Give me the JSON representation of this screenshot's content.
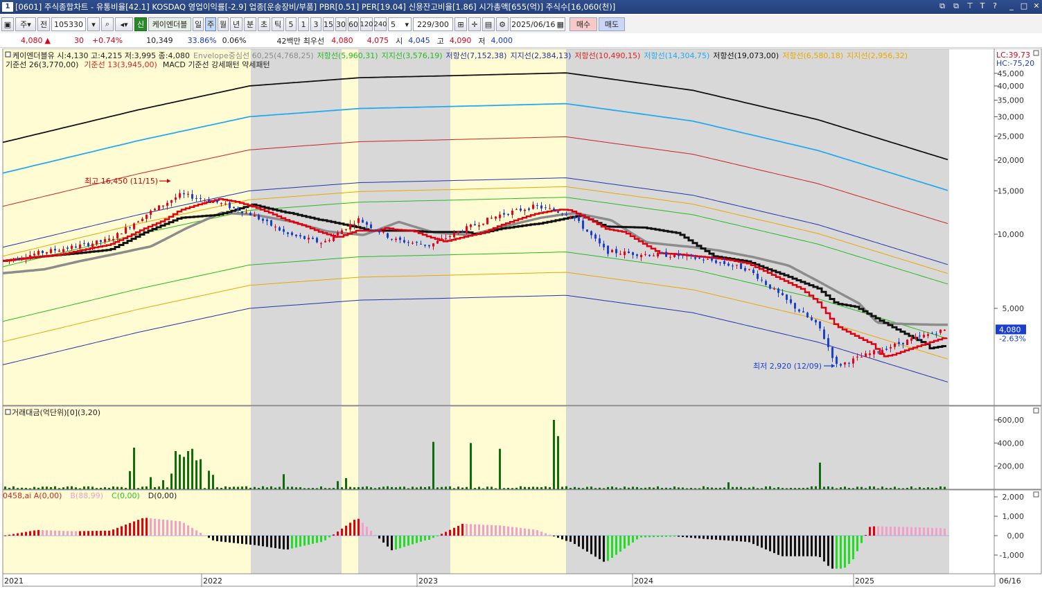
{
  "window": {
    "number": "1",
    "title": "[0601] 주식종합차트 - 유통비율[42.1] KOSDAQ 영업이익률[-2.9] 업종[운송장비/부품] PBR[0.51] PER[19.04] 신용잔고비율[1.86] 시가총액[655(억)] 주식수[16,060(천)]",
    "controls": [
      "⧉",
      "⧉",
      "T",
      "?",
      "_",
      "□",
      "✕"
    ]
  },
  "toolbar": {
    "market_code": "주",
    "prev_label": "전",
    "stock_code": "105330",
    "credit_badge": "신",
    "stock_name": "케이엔더블",
    "periods": [
      "일",
      "주",
      "월",
      "년",
      "분",
      "초",
      "틱"
    ],
    "active_period": "주",
    "intervals": [
      "5",
      "1",
      "3",
      "15",
      "30",
      "60",
      "120",
      "240"
    ],
    "interval_value": "5",
    "count_value": "229",
    "count_total": "/300",
    "date_value": "2025/06/16",
    "buy_label": "매수",
    "sell_label": "매도"
  },
  "quote": {
    "price": "4,080",
    "change_arrow": "▲",
    "change": "30",
    "change_pct": "+0.74%",
    "volume": "10,349",
    "turnover_pct": "33.86%",
    "ratio_pct": "0.06%",
    "amount": "42백만",
    "best_label": "최우선",
    "best_ask": "4,080",
    "best_bid": "4,075",
    "open_label": "시",
    "open": "4,045",
    "high_label": "고",
    "high": "4,090",
    "low_label": "저",
    "low": "4,000"
  },
  "legend": {
    "line1": [
      {
        "text": "케이엔더블유 시:4,130 고:4,215 저:3,995 종:4,080",
        "color": "#222222"
      },
      {
        "text": "Envelope중심선 60,25(4,768,25)",
        "color": "#8c8c8c"
      },
      {
        "text": "저항선(5,960,31)",
        "color": "#22bb22"
      },
      {
        "text": "지지선(3,576,19)",
        "color": "#22bb22"
      },
      {
        "text": "저항선(7,152,38)",
        "color": "#2233aa"
      },
      {
        "text": "지지선(2,384,13)",
        "color": "#2233aa"
      },
      {
        "text": "저항선(10,490,15)",
        "color": "#dd2222"
      },
      {
        "text": "저항선(14,304,75)",
        "color": "#22aaee"
      },
      {
        "text": "저항선(19,073,00)",
        "color": "#111111"
      },
      {
        "text": "저항선(6,580,18)",
        "color": "#e8a800"
      },
      {
        "text": "지지선(2,956,32)",
        "color": "#e8a800"
      }
    ],
    "line2": [
      {
        "text": "기준선 26(3,770,00)",
        "color": "#222222"
      },
      {
        "text": "기준선 13(3,945,00)",
        "color": "#dd2222"
      },
      {
        "text": "MACD 기준선 강세패턴  약세패턴",
        "color": "#222222"
      }
    ]
  },
  "colors": {
    "shade_yellow": "#fffbd2",
    "shade_gray": "#d8d8d8",
    "candle_up": "#e8001e",
    "candle_down": "#1a3fcf",
    "volume_bar": "#0e6b0e"
  },
  "price_axis": {
    "lc": "LC:39,73",
    "hc": "HC:-75,20",
    "ticks": [
      "45,000",
      "40,000",
      "35,000",
      "30,000",
      "25,000",
      "20,000",
      "15,000",
      "10,000",
      "5,000"
    ],
    "current_price": "4,080",
    "current_pct": "-2.63%"
  },
  "annotations": {
    "high": "최고 16,450 (11/15)",
    "low": "최저 2,920 (12/09)"
  },
  "volume_panel": {
    "title": "거래대금(억단위)[0](3,20)",
    "ticks": [
      "600,00",
      "400,00",
      "200,00"
    ]
  },
  "macd_panel": {
    "title_parts": [
      {
        "text": "0458,ai A(0,00)",
        "color": "#dd2222"
      },
      {
        "text": "B(88,99)",
        "color": "#f2a0c8"
      },
      {
        "text": "C(0,00)",
        "color": "#22cc22"
      },
      {
        "text": "D(0,00)",
        "color": "#222222"
      }
    ],
    "ticks": [
      "2,000",
      "1,000",
      "0,00",
      "-1,000"
    ]
  },
  "x_axis": {
    "years": [
      "2021",
      "2022",
      "2023",
      "2024",
      "2025"
    ],
    "end_label": "06/16"
  },
  "chart_data": {
    "type": "candlestick",
    "frequency": "weekly",
    "y_scale": "log",
    "ylim": [
      2400,
      50000
    ],
    "x_range": [
      "2021-01",
      "2025-06-16"
    ],
    "high_point": {
      "value": 16450,
      "date": "11/15"
    },
    "low_point": {
      "value": 2920,
      "date": "12/09"
    },
    "last": {
      "open": 4130,
      "high": 4215,
      "low": 3995,
      "close": 4080
    },
    "close_path": [
      {
        "x": "2021-01",
        "y": 7800
      },
      {
        "x": "2021-03",
        "y": 8400
      },
      {
        "x": "2021-05",
        "y": 8900
      },
      {
        "x": "2021-07",
        "y": 9500
      },
      {
        "x": "2021-09",
        "y": 12000
      },
      {
        "x": "2021-11",
        "y": 14500
      },
      {
        "x": "2022-01",
        "y": 13500
      },
      {
        "x": "2022-03",
        "y": 12000
      },
      {
        "x": "2022-05",
        "y": 10000
      },
      {
        "x": "2022-07",
        "y": 9200
      },
      {
        "x": "2022-09",
        "y": 11500
      },
      {
        "x": "2022-11",
        "y": 9500
      },
      {
        "x": "2023-01",
        "y": 9000
      },
      {
        "x": "2023-03",
        "y": 10500
      },
      {
        "x": "2023-05",
        "y": 12000
      },
      {
        "x": "2023-07",
        "y": 13000
      },
      {
        "x": "2023-09",
        "y": 12000
      },
      {
        "x": "2023-11",
        "y": 8500
      },
      {
        "x": "2024-01",
        "y": 8300
      },
      {
        "x": "2024-03",
        "y": 8200
      },
      {
        "x": "2024-05",
        "y": 7800
      },
      {
        "x": "2024-07",
        "y": 7200
      },
      {
        "x": "2024-09",
        "y": 5500
      },
      {
        "x": "2024-11",
        "y": 4200
      },
      {
        "x": "2024-12",
        "y": 2920
      },
      {
        "x": "2025-02",
        "y": 3300
      },
      {
        "x": "2025-04",
        "y": 3700
      },
      {
        "x": "2025-06",
        "y": 4080
      }
    ]
  }
}
